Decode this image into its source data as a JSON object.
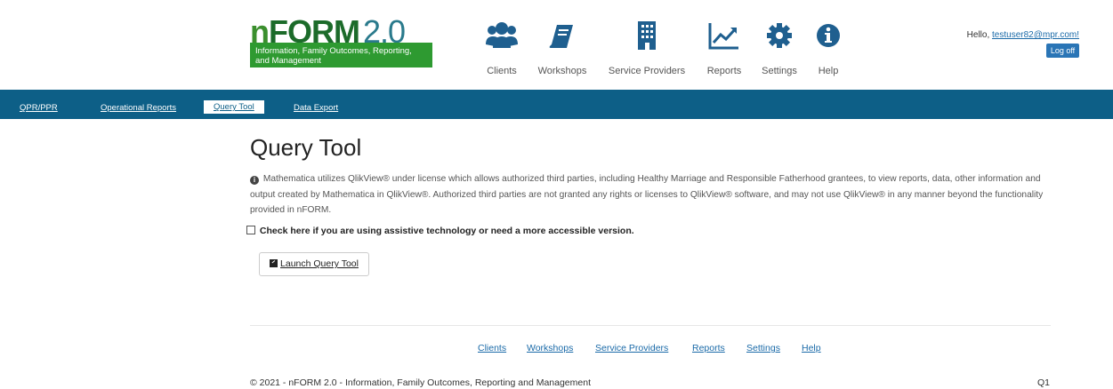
{
  "logo": {
    "n": "n",
    "form": "FORM",
    "version": "2.0",
    "subtitle_line1": "Information, Family Outcomes, Reporting,",
    "subtitle_line2": "and Management"
  },
  "nav": [
    {
      "label": "Clients",
      "icon": "users-icon"
    },
    {
      "label": "Workshops",
      "icon": "book-icon"
    },
    {
      "label": "Service Providers",
      "icon": "building-icon"
    },
    {
      "label": "Reports",
      "icon": "line-chart-icon"
    },
    {
      "label": "Settings",
      "icon": "gear-icon"
    },
    {
      "label": "Help",
      "icon": "info-icon"
    }
  ],
  "user": {
    "greeting": "Hello,",
    "email": "testuser82@mpr.com!",
    "logoff": "Log off"
  },
  "subnav": [
    {
      "label": "QPR/PPR",
      "active": false
    },
    {
      "label": "Operational Reports",
      "active": false
    },
    {
      "label": "Query Tool",
      "active": true
    },
    {
      "label": "Data Export",
      "active": false
    }
  ],
  "page": {
    "title": "Query Tool",
    "notice": "Mathematica utilizes QlikView® under license which allows authorized third parties, including Healthy Marriage and Responsible Fatherhood grantees, to view reports, data, other information and output created by Mathematica in QlikView®. Authorized third parties are not granted any rights or licenses to QlikView® software, and may not use QlikView® in any manner beyond the functionality provided in nFORM.",
    "checkbox_label": "Check here if you are using assistive technology or need a more accessible version.",
    "checkbox_checked": false,
    "launch_button": "Launch Query Tool"
  },
  "footer": {
    "links": [
      "Clients",
      "Workshops",
      "Service Providers",
      "Reports",
      "Settings",
      "Help"
    ],
    "copyright": "© 2021 - nFORM 2.0 - Information, Family Outcomes, Reporting and Management",
    "version_tag": "Q1"
  },
  "colors": {
    "bar": "#0d5f87",
    "logo_green": "#2e9a31",
    "link": "#1a6aa8"
  }
}
